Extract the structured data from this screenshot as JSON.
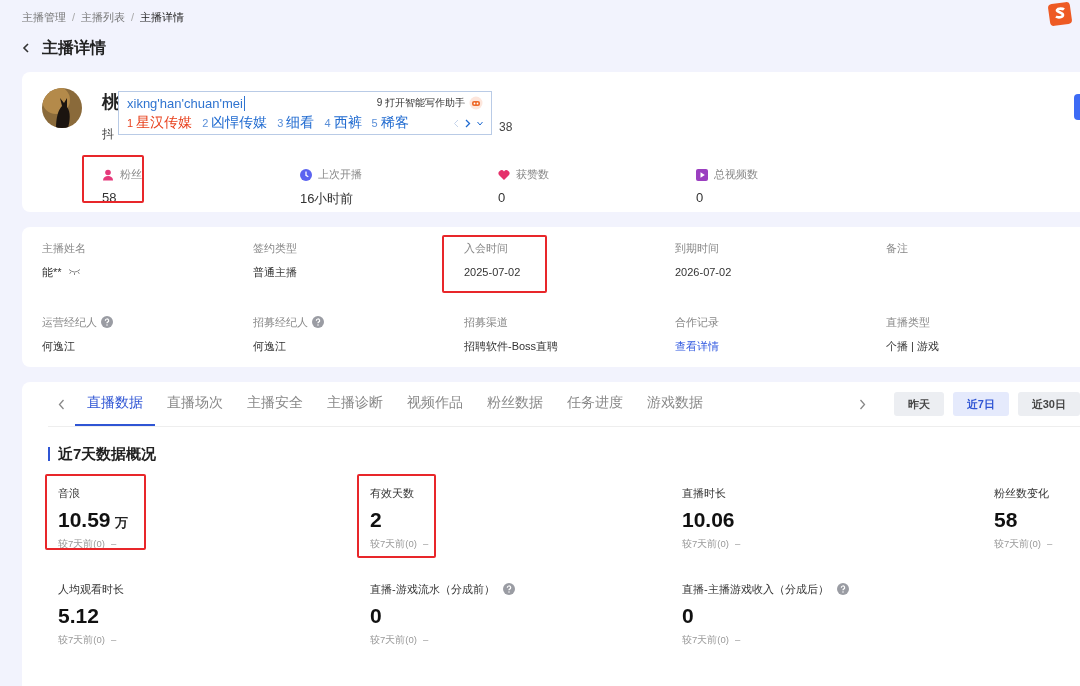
{
  "breadcrumb": [
    {
      "label": "主播管理",
      "current": false
    },
    {
      "separator": "/"
    },
    {
      "label": "主播列表",
      "current": false
    },
    {
      "separator": "/"
    },
    {
      "label": "主播详情",
      "current": true
    }
  ],
  "page_title": "主播详情",
  "profile": {
    "name": "桃",
    "platform": "抖",
    "id_tail": "38"
  },
  "ime": {
    "input": "xikng'han'chuan'mei",
    "assistant": "9 打开智能写作助手",
    "candidates": [
      {
        "index": "1",
        "text": "星汉传媒",
        "selected": true
      },
      {
        "index": "2",
        "text": "凶悍传媒",
        "selected": false
      },
      {
        "index": "3",
        "text": "细看",
        "selected": false
      },
      {
        "index": "4",
        "text": "西裤",
        "selected": false
      },
      {
        "index": "5",
        "text": "稀客",
        "selected": false
      }
    ]
  },
  "stats": [
    {
      "kind": "fans",
      "label": "粉丝",
      "value": "58",
      "highlighted": true
    },
    {
      "kind": "last_live",
      "label": "上次开播",
      "value": "16小时前",
      "highlighted": false
    },
    {
      "kind": "likes",
      "label": "获赞数",
      "value": "0",
      "highlighted": false
    },
    {
      "kind": "videos",
      "label": "总视频数",
      "value": "0",
      "highlighted": false
    }
  ],
  "info": [
    {
      "label": "主播姓名",
      "value": "能**",
      "kind": "masked",
      "help": false,
      "highlighted": false
    },
    {
      "label": "签约类型",
      "value": "普通主播",
      "kind": "text",
      "help": false,
      "highlighted": false
    },
    {
      "label": "入会时间",
      "value": "2025-07-02",
      "kind": "text",
      "help": false,
      "highlighted": true
    },
    {
      "label": "到期时间",
      "value": "2026-07-02",
      "kind": "text",
      "help": false,
      "highlighted": false
    },
    {
      "label": "备注",
      "kind": "text",
      "help": false,
      "highlighted": false
    },
    {
      "label": "运营经纪人",
      "value": "何逸江",
      "kind": "text",
      "help": true,
      "highlighted": false
    },
    {
      "label": "招募经纪人",
      "value": "何逸江",
      "kind": "text",
      "help": true,
      "highlighted": false
    },
    {
      "label": "招募渠道",
      "value": "招聘软件-Boss直聘",
      "kind": "text",
      "help": false,
      "highlighted": false
    },
    {
      "label": "合作记录",
      "value": "查看详情",
      "kind": "link",
      "help": false,
      "highlighted": false
    },
    {
      "label": "直播类型",
      "value": "个播 | 游戏",
      "kind": "text",
      "help": false,
      "highlighted": false
    }
  ],
  "tabs": [
    {
      "label": "直播数据",
      "selected": true
    },
    {
      "label": "直播场次",
      "selected": false
    },
    {
      "label": "主播安全",
      "selected": false
    },
    {
      "label": "主播诊断",
      "selected": false
    },
    {
      "label": "视频作品",
      "selected": false
    },
    {
      "label": "粉丝数据",
      "selected": false
    },
    {
      "label": "任务进度",
      "selected": false
    },
    {
      "label": "游戏数据",
      "selected": false
    }
  ],
  "ranges": [
    {
      "label": "昨天",
      "selected": false
    },
    {
      "label": "近7日",
      "selected": true
    },
    {
      "label": "近30日",
      "selected": false
    }
  ],
  "section_title": "近7天数据概况",
  "metrics": [
    {
      "label": "音浪",
      "value": "10.59",
      "unit": "万",
      "compare": "较7天前(0)",
      "trend": "–",
      "help": false,
      "highlighted": true
    },
    {
      "label": "有效天数",
      "value": "2",
      "compare": "较7天前(0)",
      "trend": "–",
      "help": false,
      "highlighted": true
    },
    {
      "label": "直播时长",
      "value": "10.06",
      "compare": "较7天前(0)",
      "trend": "–",
      "help": false,
      "highlighted": false
    },
    {
      "label": "粉丝数变化",
      "value": "58",
      "compare": "较7天前(0)",
      "trend": "–",
      "help": false,
      "highlighted": false
    },
    {
      "label": "人均观看时长",
      "value": "5.12",
      "compare": "较7天前(0)",
      "trend": "–",
      "help": false,
      "highlighted": false
    },
    {
      "label": "直播-游戏流水（分成前）",
      "value": "0",
      "compare": "较7天前(0)",
      "trend": "–",
      "help": true,
      "highlighted": false
    },
    {
      "label": "直播-主播游戏收入（分成后）",
      "value": "0",
      "compare": "较7天前(0)",
      "trend": "–",
      "help": true,
      "highlighted": false
    }
  ]
}
